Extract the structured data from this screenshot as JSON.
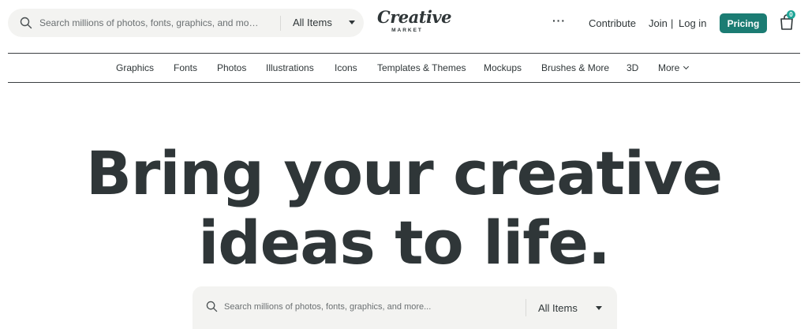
{
  "header": {
    "search": {
      "placeholder": "Search millions of photos, fonts, graphics, and mo…",
      "category": "All Items"
    },
    "logo": {
      "word": "Creative",
      "sub": "MARKET"
    },
    "more_menu": "···",
    "contribute": "Contribute",
    "join": "Join",
    "separator": "|",
    "login": "Log in",
    "pricing": "Pricing",
    "cart_count": "0"
  },
  "nav": {
    "items": [
      {
        "label": "Graphics"
      },
      {
        "label": "Fonts"
      },
      {
        "label": "Photos"
      },
      {
        "label": "Illustrations"
      },
      {
        "label": "Icons"
      },
      {
        "label": "Templates & Themes"
      },
      {
        "label": "Mockups"
      },
      {
        "label": "Brushes & More"
      },
      {
        "label": "3D"
      },
      {
        "label": "More"
      }
    ]
  },
  "hero": {
    "line1": "Bring your creative",
    "line2": "ideas to life.",
    "search": {
      "placeholder": "Search millions of photos, fonts, graphics, and more...",
      "category": "All Items"
    }
  },
  "colors": {
    "accent": "#1b7c73",
    "text": "#2f3638",
    "search_bg": "#f3f3f1"
  }
}
